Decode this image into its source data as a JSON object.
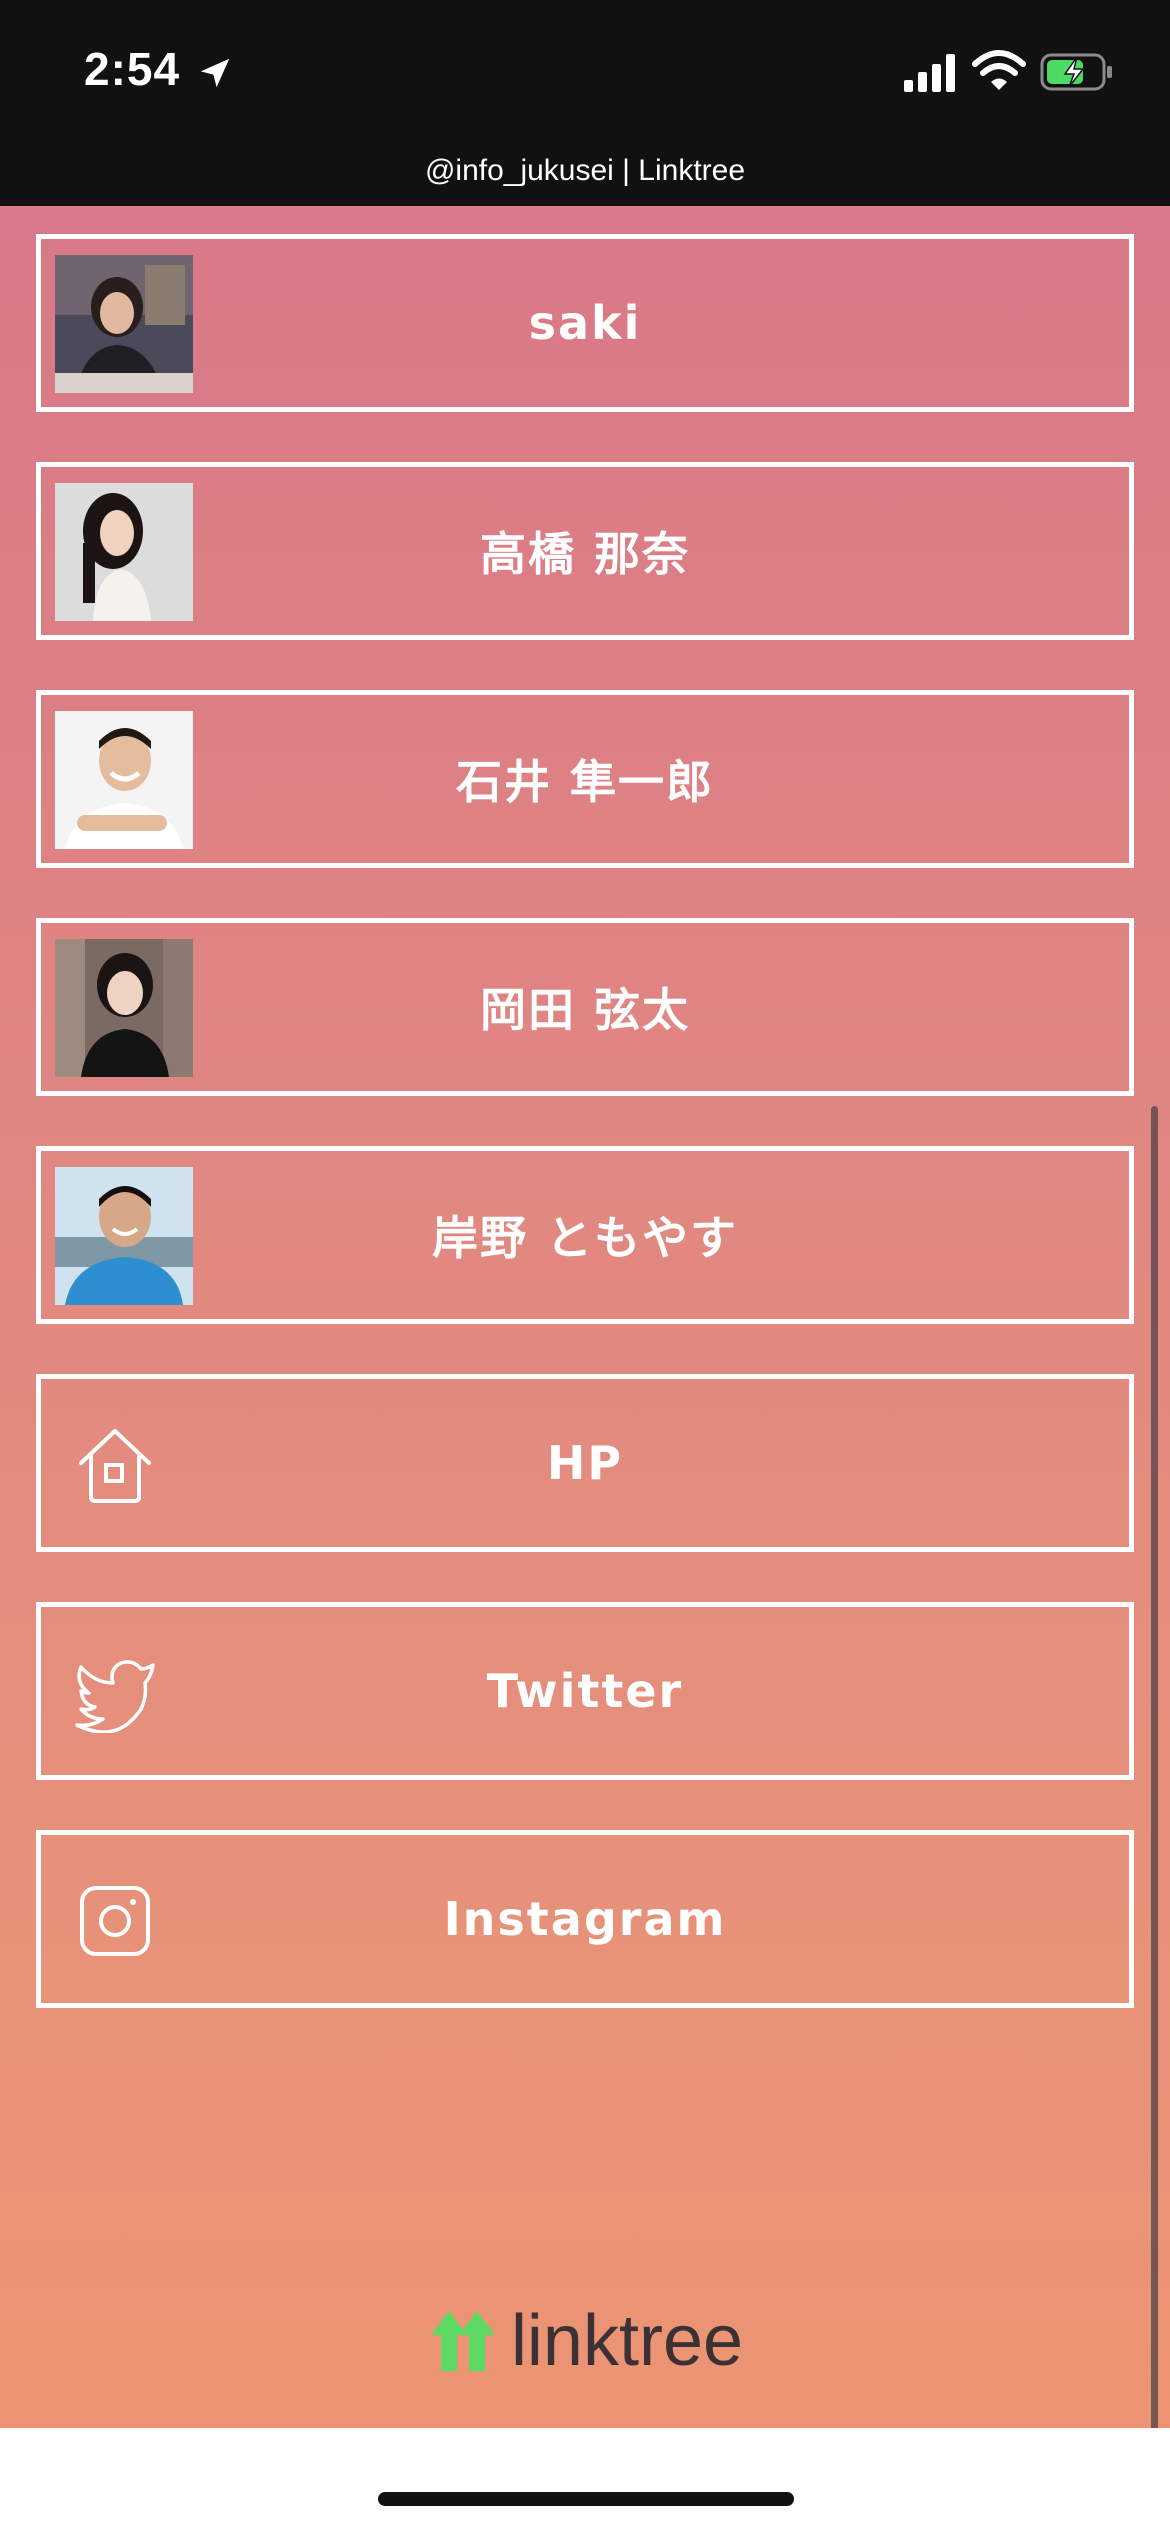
{
  "status_bar": {
    "time": "2:54",
    "page_url": "@info_jukusei | Linktree"
  },
  "links": [
    {
      "label": "saki",
      "thumbnail": "photo"
    },
    {
      "label": "高橋 那奈",
      "thumbnail": "photo"
    },
    {
      "label": "石井 隼一郎",
      "thumbnail": "photo"
    },
    {
      "label": "岡田 弦太",
      "thumbnail": "photo"
    },
    {
      "label": "岸野 ともやす",
      "thumbnail": "photo"
    },
    {
      "label": "HP",
      "icon": "home-icon"
    },
    {
      "label": "Twitter",
      "icon": "twitter-bird-icon"
    },
    {
      "label": "Instagram",
      "icon": "instagram-icon"
    }
  ],
  "footer": {
    "logo_text": "linktree"
  },
  "colors": {
    "status_bar_bg": "#111111",
    "gradient_top": "#d97888",
    "gradient_bottom": "#ec9472",
    "button_border": "#ffffff",
    "logo_green": "#43e660",
    "logo_text": "#3c3134"
  }
}
